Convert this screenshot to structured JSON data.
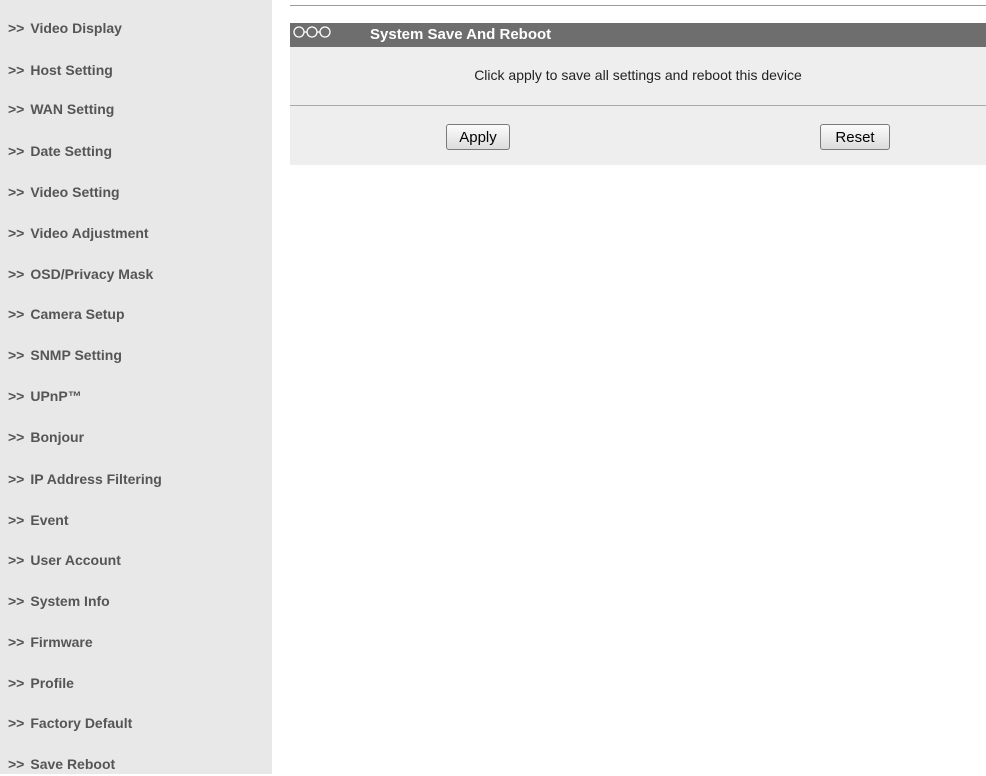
{
  "sidebar": {
    "arrow": ">>",
    "items": [
      {
        "label": "Video Display"
      },
      {
        "label": "Host Setting"
      },
      {
        "label": "WAN Setting"
      },
      {
        "label": "Date Setting"
      },
      {
        "label": "Video Setting"
      },
      {
        "label": "Video Adjustment"
      },
      {
        "label": "OSD/Privacy Mask"
      },
      {
        "label": "Camera Setup"
      },
      {
        "label": "SNMP Setting"
      },
      {
        "label": "UPnP™"
      },
      {
        "label": "Bonjour"
      },
      {
        "label": "IP Address Filtering"
      },
      {
        "label": "Event"
      },
      {
        "label": "User Account"
      },
      {
        "label": "System Info"
      },
      {
        "label": "Firmware"
      },
      {
        "label": "Profile"
      },
      {
        "label": "Factory Default"
      },
      {
        "label": "Save Reboot"
      }
    ]
  },
  "panel": {
    "icon": "chain-rings-icon",
    "title": "System Save And Reboot",
    "message": "Click apply to save all settings and reboot this device",
    "apply_label": "Apply",
    "reset_label": "Reset"
  },
  "colors": {
    "sidebar_bg": "#e8e8e8",
    "sidebar_text": "#555555",
    "header_bg": "#6e6e6e",
    "panel_bg": "#eeeeee"
  }
}
